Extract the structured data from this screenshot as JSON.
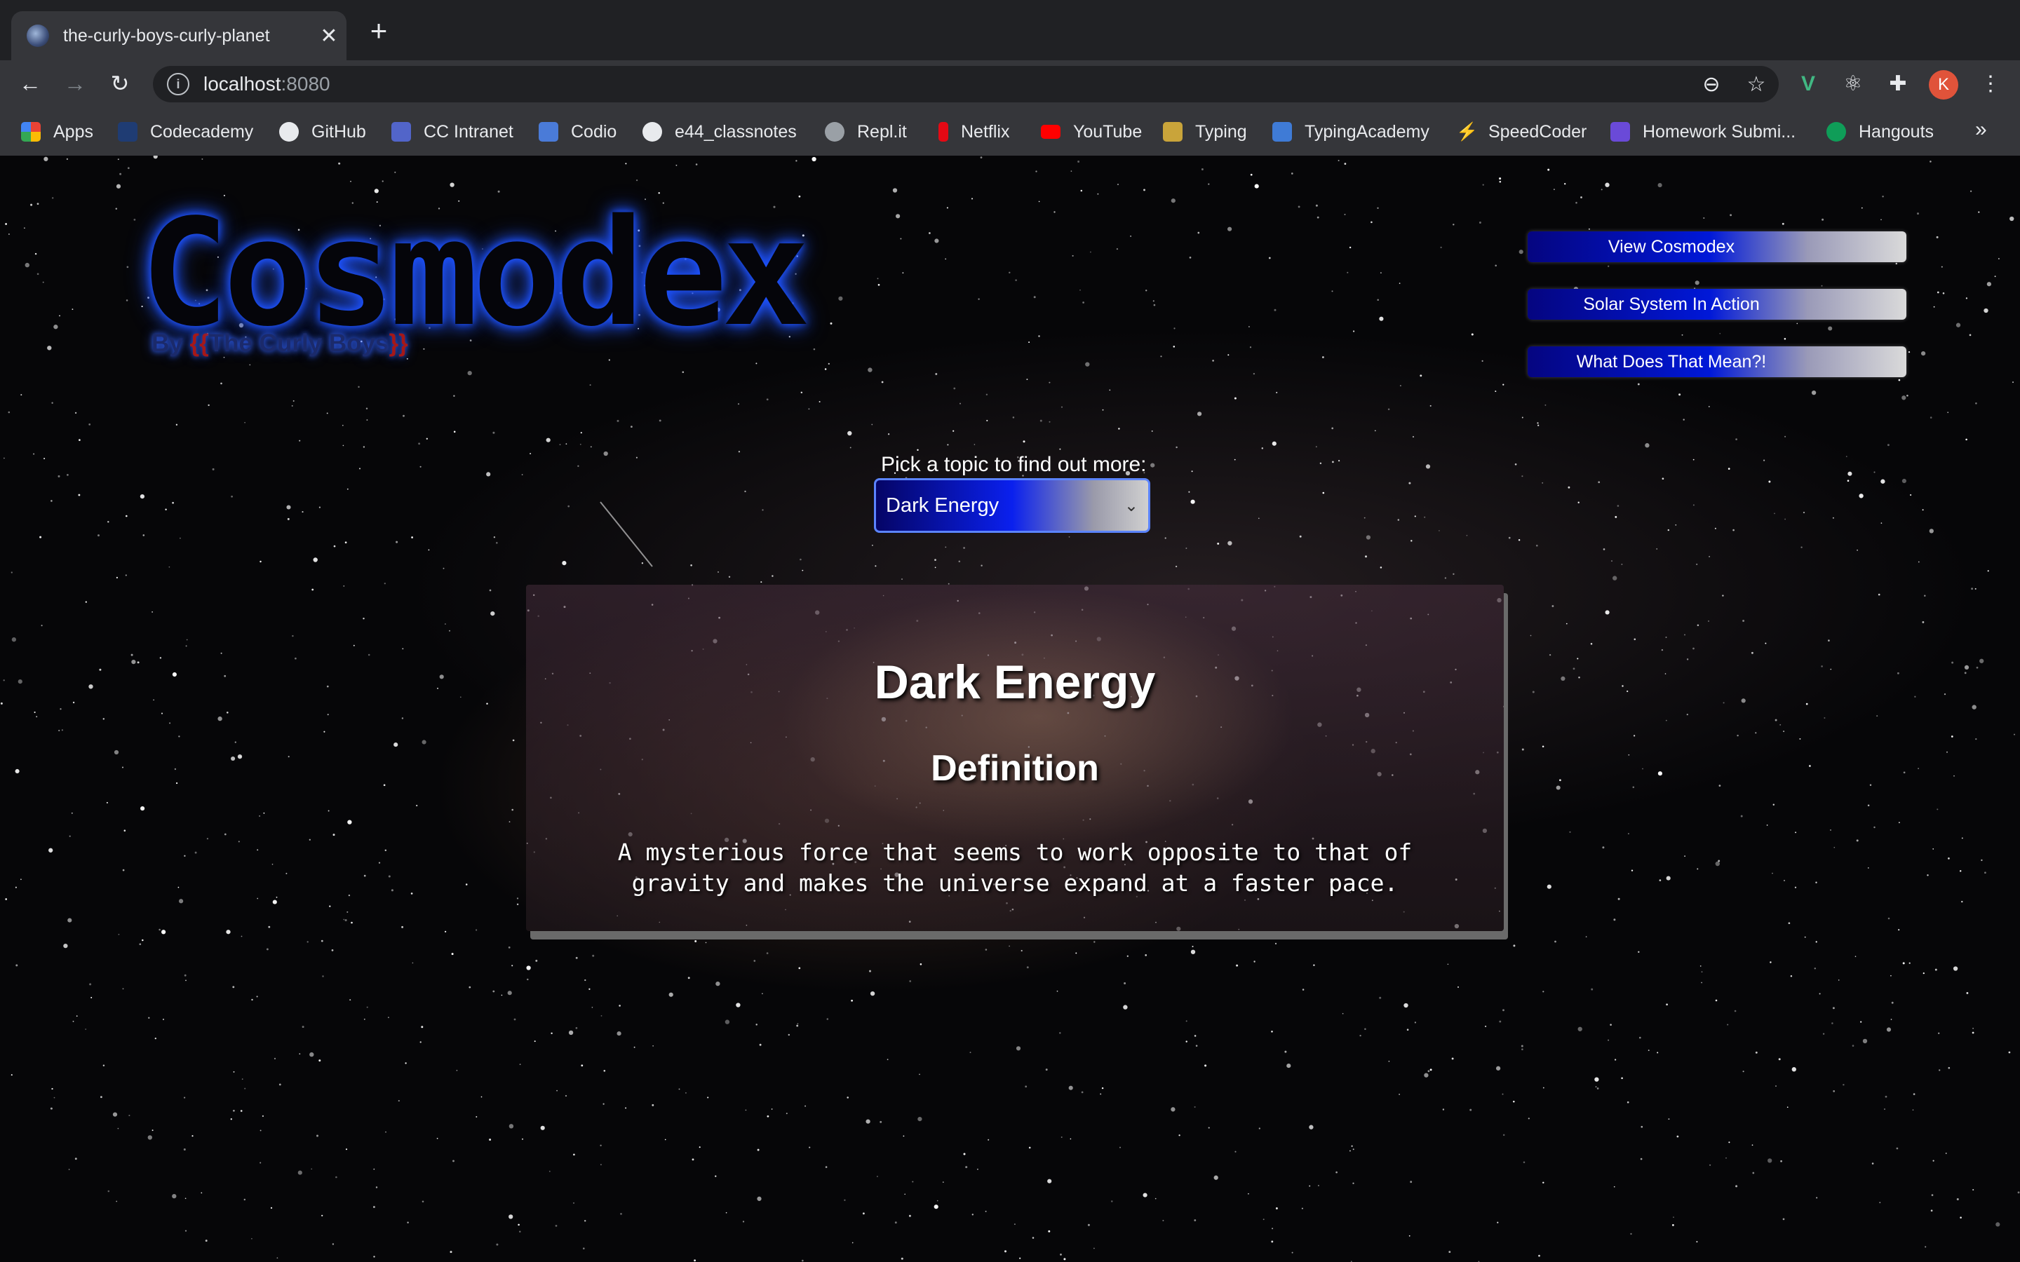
{
  "browser": {
    "tab_title": "the-curly-boys-curly-planet",
    "url_host": "localhost",
    "url_port": ":8080",
    "bookmarks": [
      {
        "label": "Apps",
        "icon": "apps-grid-icon",
        "color": "#ea4335"
      },
      {
        "label": "Codecademy",
        "icon": "codecademy-icon",
        "color": "#1f3c73"
      },
      {
        "label": "GitHub",
        "icon": "github-icon",
        "color": "#e8eaed"
      },
      {
        "label": "CC Intranet",
        "icon": "intranet-icon",
        "color": "#5265c9"
      },
      {
        "label": "Codio",
        "icon": "codio-icon",
        "color": "#4a7bd8"
      },
      {
        "label": "e44_classnotes",
        "icon": "github-icon",
        "color": "#e8eaed"
      },
      {
        "label": "Repl.it",
        "icon": "replit-icon",
        "color": "#9aa0a6"
      },
      {
        "label": "Netflix",
        "icon": "netflix-icon",
        "color": "#e50914"
      },
      {
        "label": "YouTube",
        "icon": "youtube-icon",
        "color": "#ff0000"
      },
      {
        "label": "Typing",
        "icon": "typing-icon",
        "color": "#c9a43a"
      },
      {
        "label": "TypingAcademy",
        "icon": "typingacademy-icon",
        "color": "#3f7bd6"
      },
      {
        "label": "SpeedCoder",
        "icon": "speedcoder-icon",
        "color": "#222222"
      },
      {
        "label": "Homework Submi...",
        "icon": "forms-icon",
        "color": "#6a4ad8"
      },
      {
        "label": "Hangouts",
        "icon": "hangouts-icon",
        "color": "#0f9d58"
      }
    ],
    "profile_initial": "K"
  },
  "site": {
    "logo": "Cosmodex",
    "byline_prefix": "By ",
    "byline_open": "{{",
    "byline_name": "The Curly Boys",
    "byline_close": "}}",
    "nav_buttons": [
      "View Cosmodex",
      "Solar System In Action",
      "What Does That Mean?!"
    ],
    "picker_label": "Pick a topic to find out more:",
    "picker_value": "Dark Energy",
    "card": {
      "title": "Dark Energy",
      "subtitle": "Definition",
      "body": "A mysterious force that seems to work opposite to that of gravity and makes the universe expand at a faster pace."
    }
  }
}
